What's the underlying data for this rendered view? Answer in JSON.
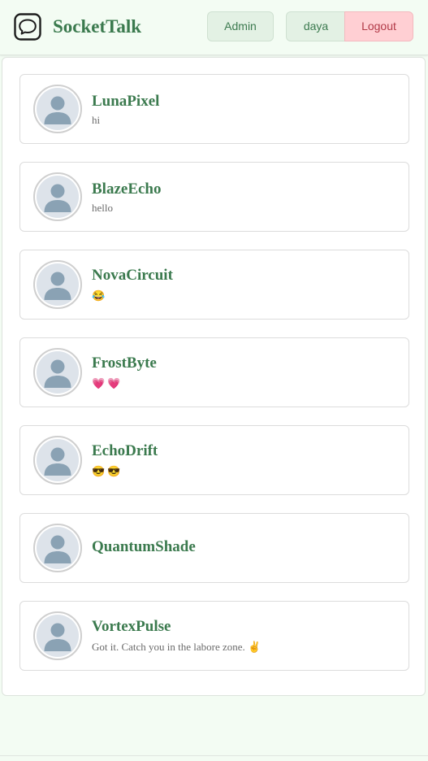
{
  "header": {
    "brand": "SocketTalk",
    "admin_label": "Admin",
    "user_label": "daya",
    "logout_label": "Logout"
  },
  "colors": {
    "accent": "#3b7a4e",
    "background": "#f3fcf3",
    "logout_bg": "#ffcfd3"
  },
  "chats": [
    {
      "name": "LunaPixel",
      "message": "hi"
    },
    {
      "name": "BlazeEcho",
      "message": "hello"
    },
    {
      "name": "NovaCircuit",
      "message": "😂"
    },
    {
      "name": "FrostByte",
      "message": "💗 💗"
    },
    {
      "name": "EchoDrift",
      "message": "😎 😎"
    },
    {
      "name": "QuantumShade",
      "message": ""
    },
    {
      "name": "VortexPulse",
      "message": "Got it. Catch you in the labore zone. ✌️"
    }
  ]
}
